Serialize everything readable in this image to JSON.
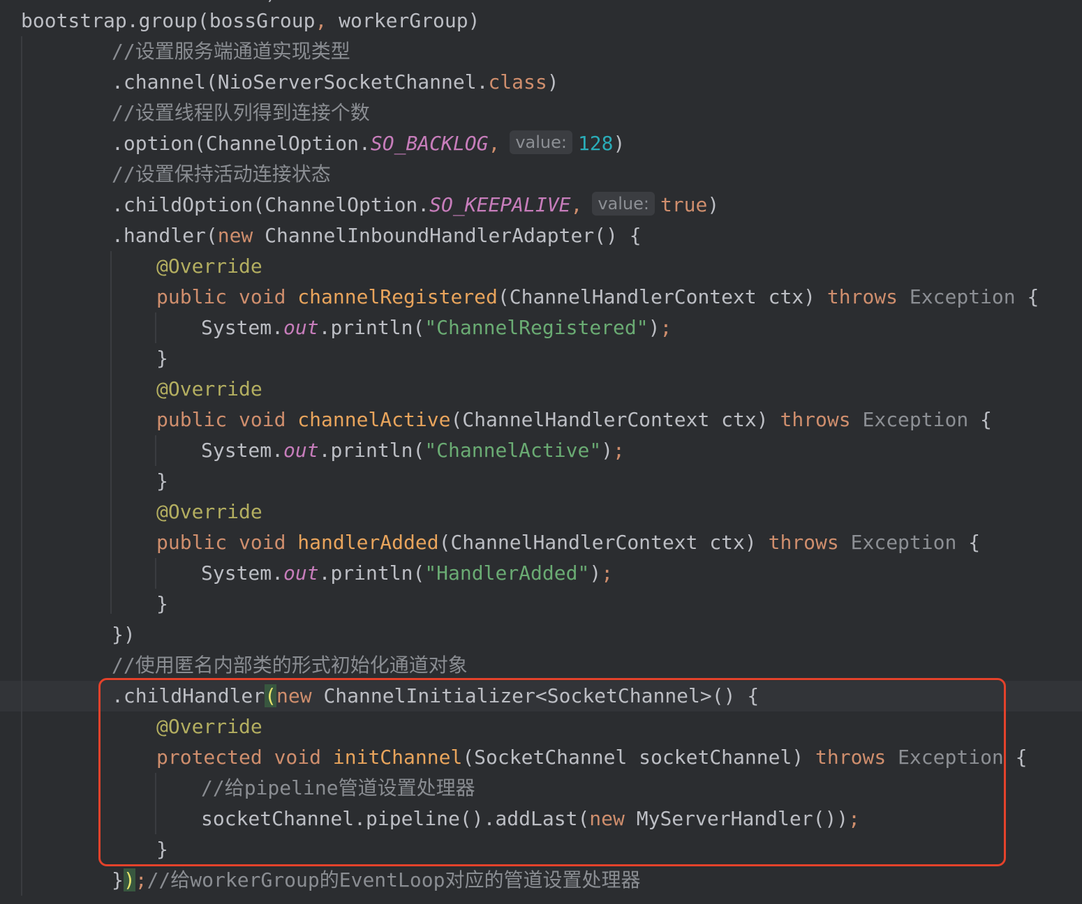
{
  "top_fragment": ")",
  "lines": [
    {
      "indent": 30,
      "tokens": [
        {
          "t": "bootstrap.group(bossGroup",
          "c": "plain"
        },
        {
          "t": ", ",
          "c": "kw"
        },
        {
          "t": "workerGroup)",
          "c": "plain"
        }
      ]
    },
    {
      "indent": 160,
      "tokens": [
        {
          "t": "//设置服务端通道实现类型",
          "c": "comment"
        }
      ]
    },
    {
      "indent": 160,
      "tokens": [
        {
          "t": ".channel(NioServerSocketChannel.",
          "c": "plain"
        },
        {
          "t": "class",
          "c": "kw"
        },
        {
          "t": ")",
          "c": "plain"
        }
      ]
    },
    {
      "indent": 160,
      "tokens": [
        {
          "t": "//设置线程队列得到连接个数",
          "c": "comment"
        }
      ]
    },
    {
      "indent": 160,
      "tokens": [
        {
          "t": ".option(ChannelOption.",
          "c": "plain"
        },
        {
          "t": "SO_BACKLOG",
          "c": "static"
        },
        {
          "t": ",",
          "c": "kw"
        },
        {
          "t": "value:",
          "c": "hint"
        },
        {
          "t": "128",
          "c": "num"
        },
        {
          "t": ")",
          "c": "plain"
        }
      ]
    },
    {
      "indent": 160,
      "tokens": [
        {
          "t": "//设置保持活动连接状态",
          "c": "comment"
        }
      ]
    },
    {
      "indent": 160,
      "tokens": [
        {
          "t": ".childOption(ChannelOption.",
          "c": "plain"
        },
        {
          "t": "SO_KEEPALIVE",
          "c": "static"
        },
        {
          "t": ",",
          "c": "kw"
        },
        {
          "t": "value:",
          "c": "hint"
        },
        {
          "t": "true",
          "c": "kw"
        },
        {
          "t": ")",
          "c": "plain"
        }
      ]
    },
    {
      "indent": 160,
      "tokens": [
        {
          "t": ".handler(",
          "c": "plain"
        },
        {
          "t": "new ",
          "c": "kw"
        },
        {
          "t": "ChannelInboundHandlerAdapter() {",
          "c": "plain"
        }
      ]
    },
    {
      "indent": 224,
      "tokens": [
        {
          "t": "@Override",
          "c": "annot"
        }
      ]
    },
    {
      "indent": 224,
      "tokens": [
        {
          "t": "public void ",
          "c": "kw"
        },
        {
          "t": "channelRegistered",
          "c": "method"
        },
        {
          "t": "(ChannelHandlerContext ctx) ",
          "c": "plain"
        },
        {
          "t": "throws ",
          "c": "kw"
        },
        {
          "t": "Exception",
          "c": "muted"
        },
        {
          "t": " {",
          "c": "plain"
        }
      ]
    },
    {
      "indent": 288,
      "tokens": [
        {
          "t": "System.",
          "c": "plain"
        },
        {
          "t": "out",
          "c": "static"
        },
        {
          "t": ".println(",
          "c": "plain"
        },
        {
          "t": "\"ChannelRegistered\"",
          "c": "string"
        },
        {
          "t": ")",
          "c": "plain"
        },
        {
          "t": ";",
          "c": "kw"
        }
      ]
    },
    {
      "indent": 224,
      "tokens": [
        {
          "t": "}",
          "c": "plain"
        }
      ]
    },
    {
      "indent": 224,
      "tokens": [
        {
          "t": "@Override",
          "c": "annot"
        }
      ]
    },
    {
      "indent": 224,
      "tokens": [
        {
          "t": "public void ",
          "c": "kw"
        },
        {
          "t": "channelActive",
          "c": "method"
        },
        {
          "t": "(ChannelHandlerContext ctx) ",
          "c": "plain"
        },
        {
          "t": "throws ",
          "c": "kw"
        },
        {
          "t": "Exception",
          "c": "muted"
        },
        {
          "t": " {",
          "c": "plain"
        }
      ]
    },
    {
      "indent": 288,
      "tokens": [
        {
          "t": "System.",
          "c": "plain"
        },
        {
          "t": "out",
          "c": "static"
        },
        {
          "t": ".println(",
          "c": "plain"
        },
        {
          "t": "\"ChannelActive\"",
          "c": "string"
        },
        {
          "t": ")",
          "c": "plain"
        },
        {
          "t": ";",
          "c": "kw"
        }
      ]
    },
    {
      "indent": 224,
      "tokens": [
        {
          "t": "}",
          "c": "plain"
        }
      ]
    },
    {
      "indent": 224,
      "tokens": [
        {
          "t": "@Override",
          "c": "annot"
        }
      ]
    },
    {
      "indent": 224,
      "tokens": [
        {
          "t": "public void ",
          "c": "kw"
        },
        {
          "t": "handlerAdded",
          "c": "method"
        },
        {
          "t": "(ChannelHandlerContext ctx) ",
          "c": "plain"
        },
        {
          "t": "throws ",
          "c": "kw"
        },
        {
          "t": "Exception",
          "c": "muted"
        },
        {
          "t": " {",
          "c": "plain"
        }
      ]
    },
    {
      "indent": 288,
      "tokens": [
        {
          "t": "System.",
          "c": "plain"
        },
        {
          "t": "out",
          "c": "static"
        },
        {
          "t": ".println(",
          "c": "plain"
        },
        {
          "t": "\"HandlerAdded\"",
          "c": "string"
        },
        {
          "t": ")",
          "c": "plain"
        },
        {
          "t": ";",
          "c": "kw"
        }
      ]
    },
    {
      "indent": 224,
      "tokens": [
        {
          "t": "}",
          "c": "plain"
        }
      ]
    },
    {
      "indent": 160,
      "tokens": [
        {
          "t": "})",
          "c": "plain"
        }
      ]
    },
    {
      "indent": 160,
      "tokens": [
        {
          "t": "//使用匿名内部类的形式初始化通道对象",
          "c": "comment"
        }
      ]
    },
    {
      "indent": 160,
      "current": true,
      "tokens": [
        {
          "t": ".childHandler",
          "c": "plain"
        },
        {
          "t": "(",
          "c": "brace-match"
        },
        {
          "t": "new ",
          "c": "kw"
        },
        {
          "t": "ChannelInitializer<SocketChannel>() {",
          "c": "plain"
        }
      ]
    },
    {
      "indent": 224,
      "tokens": [
        {
          "t": "@Override",
          "c": "annot"
        }
      ]
    },
    {
      "indent": 224,
      "tokens": [
        {
          "t": "protected void ",
          "c": "kw"
        },
        {
          "t": "initChannel",
          "c": "method"
        },
        {
          "t": "(SocketChannel socketChannel) ",
          "c": "plain"
        },
        {
          "t": "throws ",
          "c": "kw"
        },
        {
          "t": "Exception",
          "c": "muted"
        },
        {
          "t": " {",
          "c": "plain"
        }
      ]
    },
    {
      "indent": 288,
      "tokens": [
        {
          "t": "//给pipeline管道设置处理器",
          "c": "comment"
        }
      ]
    },
    {
      "indent": 288,
      "tokens": [
        {
          "t": "socketChannel.pipeline().addLast(",
          "c": "plain"
        },
        {
          "t": "new ",
          "c": "kw"
        },
        {
          "t": "MyServerHandler())",
          "c": "plain"
        },
        {
          "t": ";",
          "c": "kw"
        }
      ]
    },
    {
      "indent": 224,
      "tokens": [
        {
          "t": "}",
          "c": "plain"
        }
      ]
    },
    {
      "indent": 160,
      "tokens": [
        {
          "t": "}",
          "c": "plain"
        },
        {
          "t": ")",
          "c": "brace-match"
        },
        {
          "t": ";",
          "c": "kw"
        },
        {
          "t": "//给workerGroup的EventLoop对应的管道设置处理器",
          "c": "comment"
        }
      ]
    }
  ]
}
